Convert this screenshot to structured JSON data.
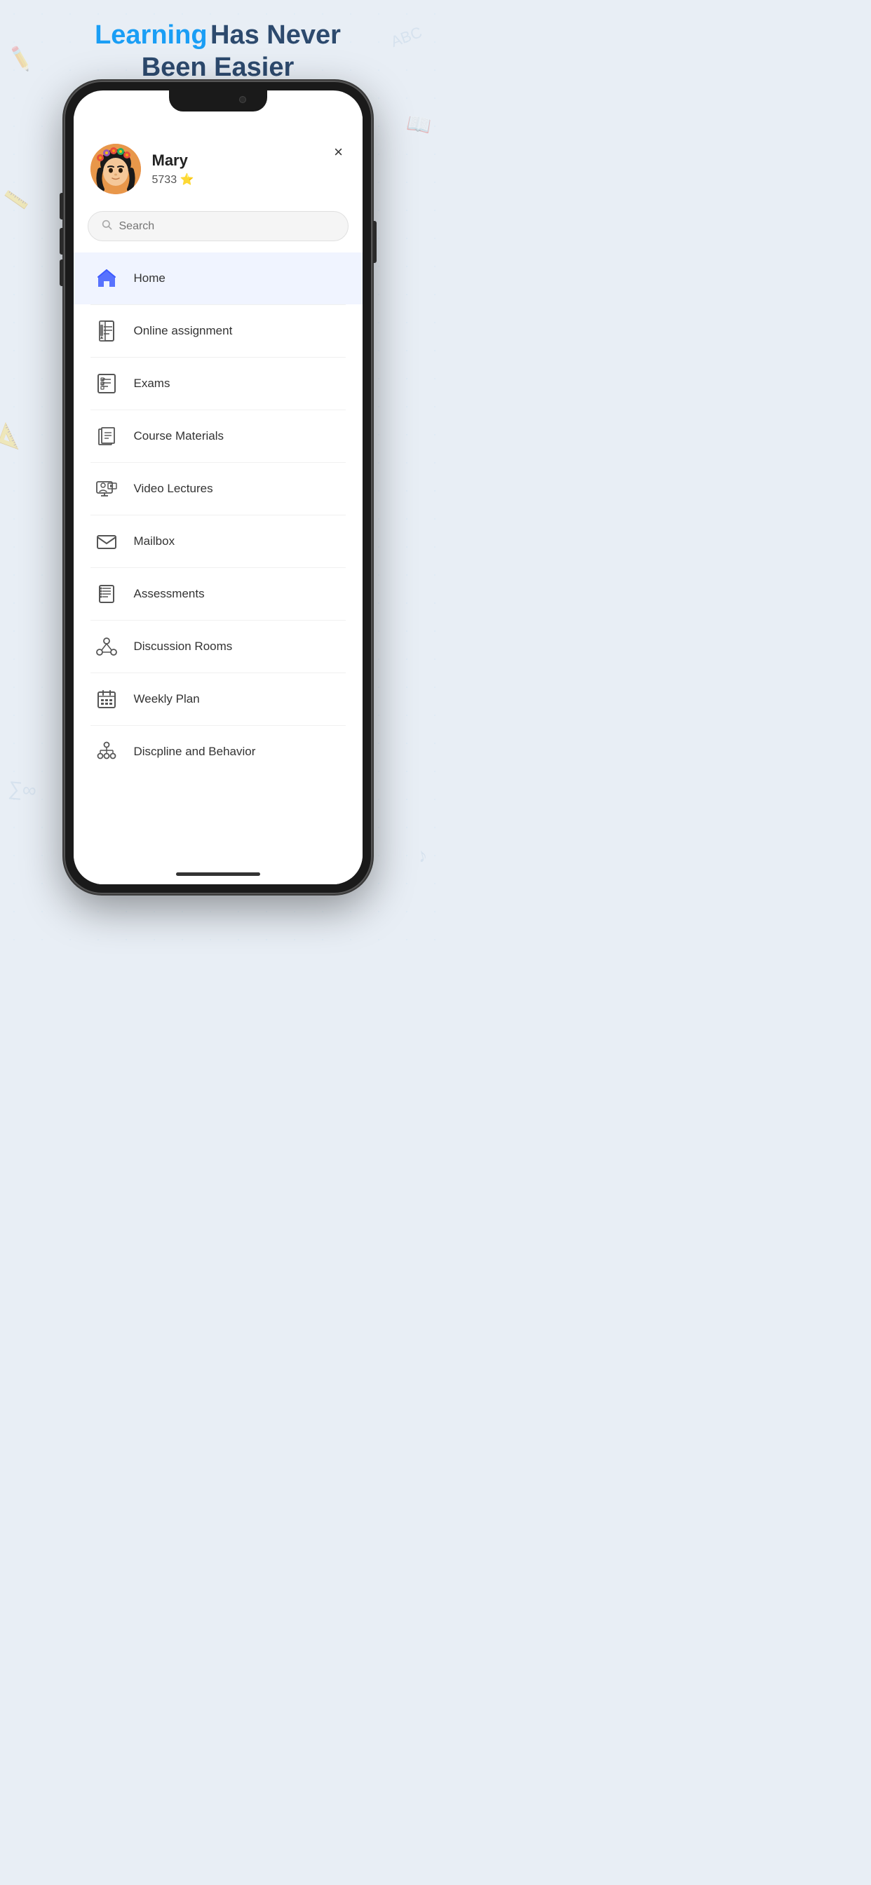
{
  "header": {
    "learning_text": "Learning",
    "rest_text": "Has Never Been Easier"
  },
  "close_button": "×",
  "user": {
    "name": "Mary",
    "points": "5733",
    "star": "⭐"
  },
  "search": {
    "placeholder": "Search"
  },
  "menu": [
    {
      "id": "home",
      "label": "Home",
      "active": true
    },
    {
      "id": "online-assignment",
      "label": "Online assignment",
      "active": false
    },
    {
      "id": "exams",
      "label": "Exams",
      "active": false
    },
    {
      "id": "course-materials",
      "label": "Course Materials",
      "active": false
    },
    {
      "id": "video-lectures",
      "label": "Video Lectures",
      "active": false
    },
    {
      "id": "mailbox",
      "label": "Mailbox",
      "active": false
    },
    {
      "id": "assessments",
      "label": "Assessments",
      "active": false
    },
    {
      "id": "discussion-rooms",
      "label": "Discussion Rooms",
      "active": false
    },
    {
      "id": "weekly-plan",
      "label": "Weekly Plan",
      "active": false
    },
    {
      "id": "discipline-behavior",
      "label": "Discpline and Behavior",
      "active": false
    }
  ]
}
